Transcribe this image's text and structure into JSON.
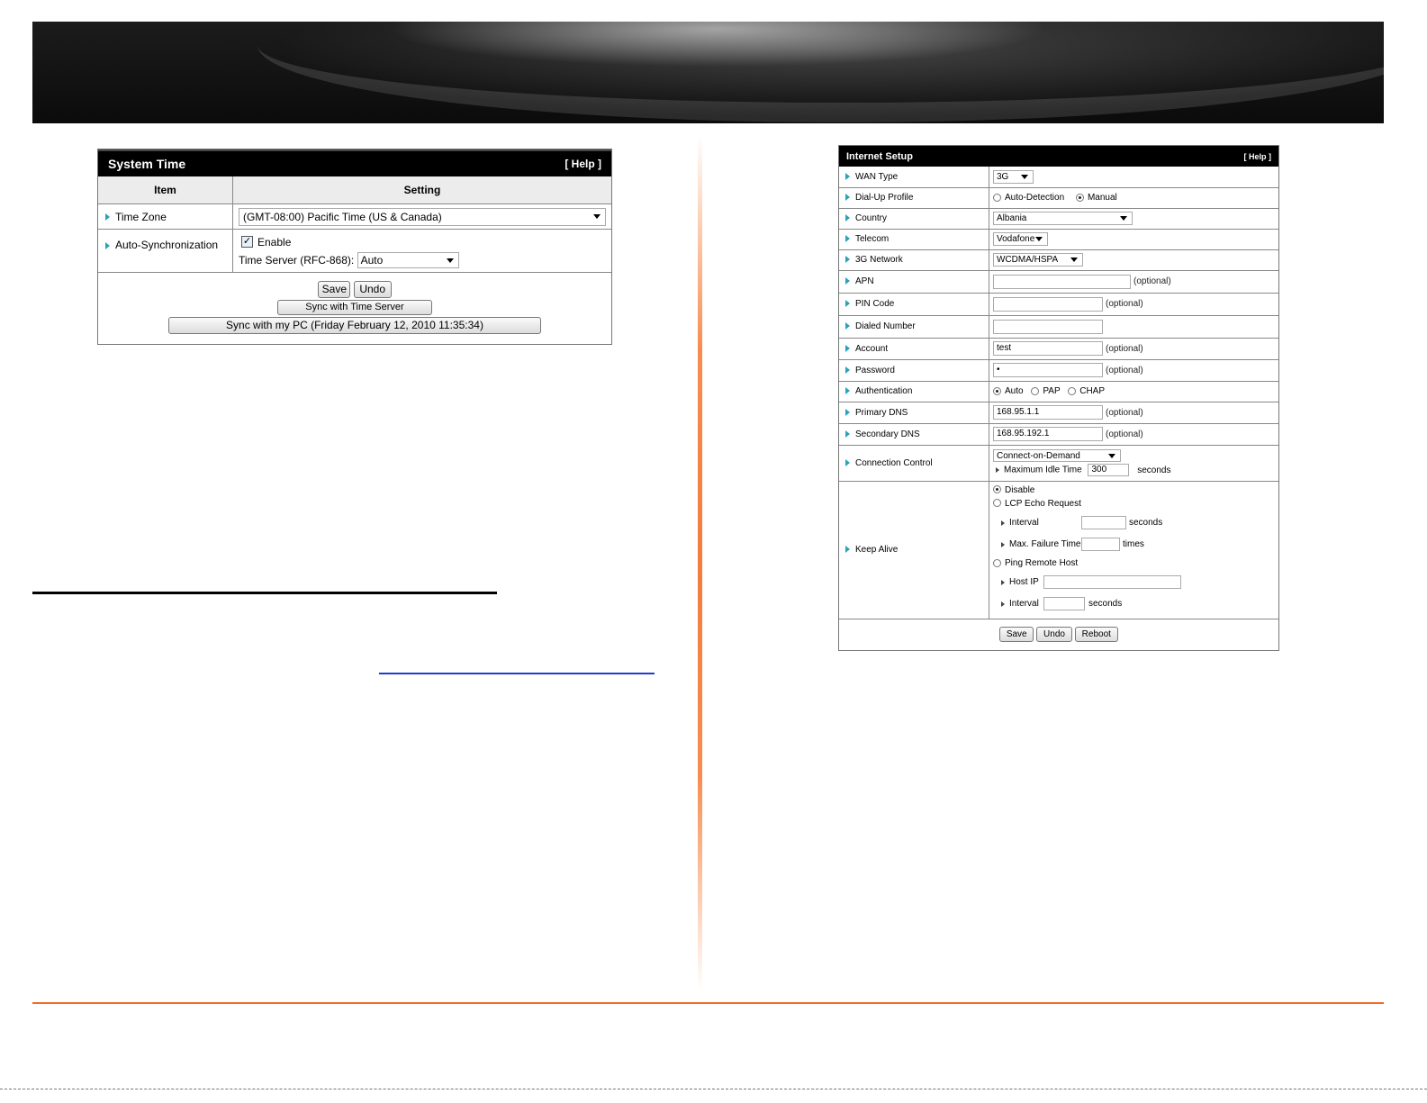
{
  "system_time": {
    "title": "System Time",
    "help": "[ Help ]",
    "col_item": "Item",
    "col_setting": "Setting",
    "time_zone_label": "Time Zone",
    "time_zone_value": "(GMT-08:00) Pacific Time (US & Canada)",
    "auto_sync_label": "Auto-Synchronization",
    "enable_label": "Enable",
    "enable_checked": true,
    "time_server_label": "Time Server (RFC-868):",
    "time_server_value": "Auto",
    "save": "Save",
    "undo": "Undo",
    "sync_server": "Sync with Time Server",
    "sync_pc": "Sync with my PC (Friday February 12, 2010 11:35:34)"
  },
  "internet_setup": {
    "title": "Internet Setup",
    "help": "[ Help ]",
    "optional": "(optional)",
    "wan_type": {
      "label": "WAN Type",
      "value": "3G"
    },
    "dial_up_profile": {
      "label": "Dial-Up Profile",
      "opt1": "Auto-Detection",
      "opt2": "Manual",
      "selected": "Manual"
    },
    "country": {
      "label": "Country",
      "value": "Albania"
    },
    "telecom": {
      "label": "Telecom",
      "value": "Vodafone"
    },
    "network": {
      "label": "3G Network",
      "value": "WCDMA/HSPA"
    },
    "apn": {
      "label": "APN",
      "value": ""
    },
    "pin": {
      "label": "PIN Code",
      "value": ""
    },
    "dialed": {
      "label": "Dialed Number",
      "value": ""
    },
    "account": {
      "label": "Account",
      "value": "test"
    },
    "password": {
      "label": "Password",
      "value": "•"
    },
    "auth": {
      "label": "Authentication",
      "opt1": "Auto",
      "opt2": "PAP",
      "opt3": "CHAP",
      "selected": "Auto"
    },
    "primary_dns": {
      "label": "Primary DNS",
      "value": "168.95.1.1"
    },
    "secondary_dns": {
      "label": "Secondary DNS",
      "value": "168.95.192.1"
    },
    "conn_control": {
      "label": "Connection Control",
      "value": "Connect-on-Demand",
      "idle_label": "Maximum Idle Time",
      "idle_value": "300",
      "idle_unit": "seconds"
    },
    "keep_alive": {
      "label": "Keep Alive",
      "disable": "Disable",
      "lcp": "LCP Echo Request",
      "interval_label": "Interval",
      "seconds": "seconds",
      "max_fail_label": "Max. Failure Time",
      "times": "times",
      "ping": "Ping Remote Host",
      "host_ip_label": "Host IP",
      "selected": "Disable"
    },
    "save": "Save",
    "undo": "Undo",
    "reboot": "Reboot"
  }
}
